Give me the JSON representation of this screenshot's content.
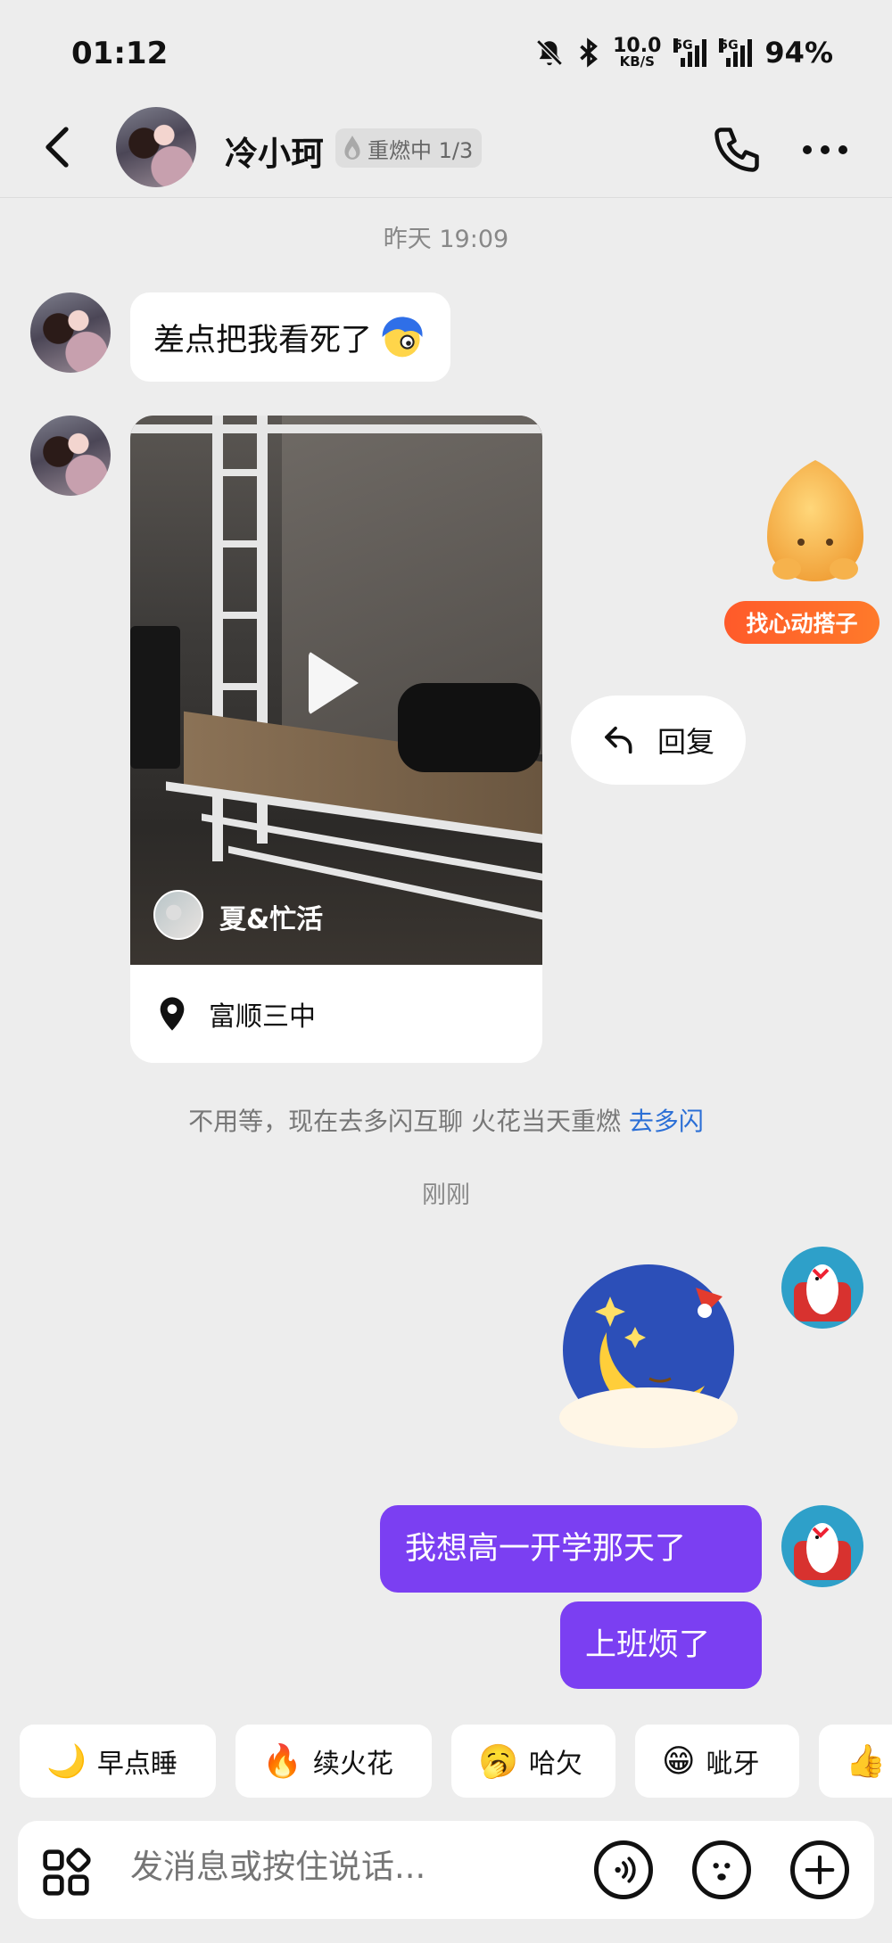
{
  "status_bar": {
    "time": "01:12",
    "net_speed_top": "10.0",
    "net_speed_bottom": "KB/S",
    "sig1_label": "5G",
    "sig2_label": "5G",
    "battery": "94%"
  },
  "header": {
    "contact_name": "冷小珂",
    "fire_status": "重燃中 1/3"
  },
  "messages": {
    "time_1": "昨天 19:09",
    "msg_1": "差点把我看死了",
    "video_author": "夏&忙活",
    "video_location": "富顺三中",
    "reply_label": "回复",
    "time_2": "刚刚",
    "msg_2": "我想高一开学那天了",
    "msg_3": "上班烦了"
  },
  "mascot_tag": "找心动搭子",
  "system_tip": {
    "text": "不用等，现在去多闪互聊 火花当天重燃 ",
    "link": "去多闪"
  },
  "quick_replies": [
    {
      "emoji": "🌙",
      "label": "早点睡"
    },
    {
      "emoji": "🔥",
      "label": "续火花"
    },
    {
      "emoji": "🥱",
      "label": "哈欠"
    },
    {
      "emoji": "😁",
      "label": "呲牙"
    }
  ],
  "input": {
    "placeholder": "发消息或按住说话..."
  },
  "colors": {
    "outgoing_bubble": "#7b3ff2",
    "link": "#2b6fd6",
    "mascot_tag": "#ff5a2a"
  }
}
